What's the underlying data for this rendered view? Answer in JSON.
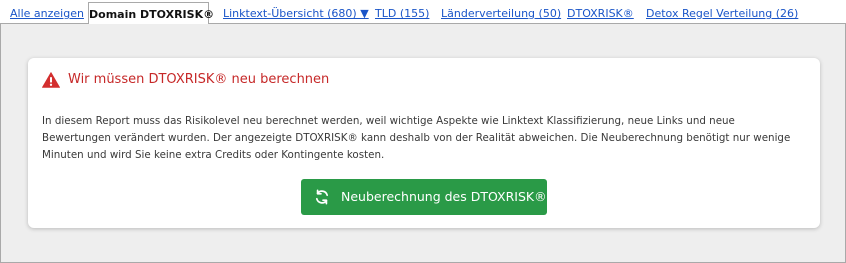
{
  "tabs": {
    "all": "Alle anzeigen",
    "active": "Domain DTOXRISK®",
    "linktext": "Linktext-Übersicht (680) ▼",
    "tld": "TLD (155)",
    "countries": "Länderverteilung (50)",
    "dtoxrisk": "DTOXRISK®",
    "detox_rules": "Detox Regel Verteilung (26)"
  },
  "alert": {
    "icon": "warning-icon",
    "title": "Wir müssen DTOXRISK® neu berechnen",
    "text": "In diesem Report muss das Risikolevel neu berechnet werden, weil wichtige Aspekte wie Linktext Klassifizierung, neue Links und neue Bewertungen verändert wurden. Der angezeigte DTOXRISK® kann deshalb von der Realität abweichen. Die Neuberechnung benötigt nur wenige Minuten und wird Sie keine extra Credits oder Kontingente kosten.",
    "button_label": "Neuberechnung des DTOXRISK®",
    "button_icon": "refresh-icon"
  },
  "colors": {
    "link": "#1a55c8",
    "warning": "#c62828",
    "button": "#2a9a47",
    "panel_background": "#eeeeee"
  }
}
